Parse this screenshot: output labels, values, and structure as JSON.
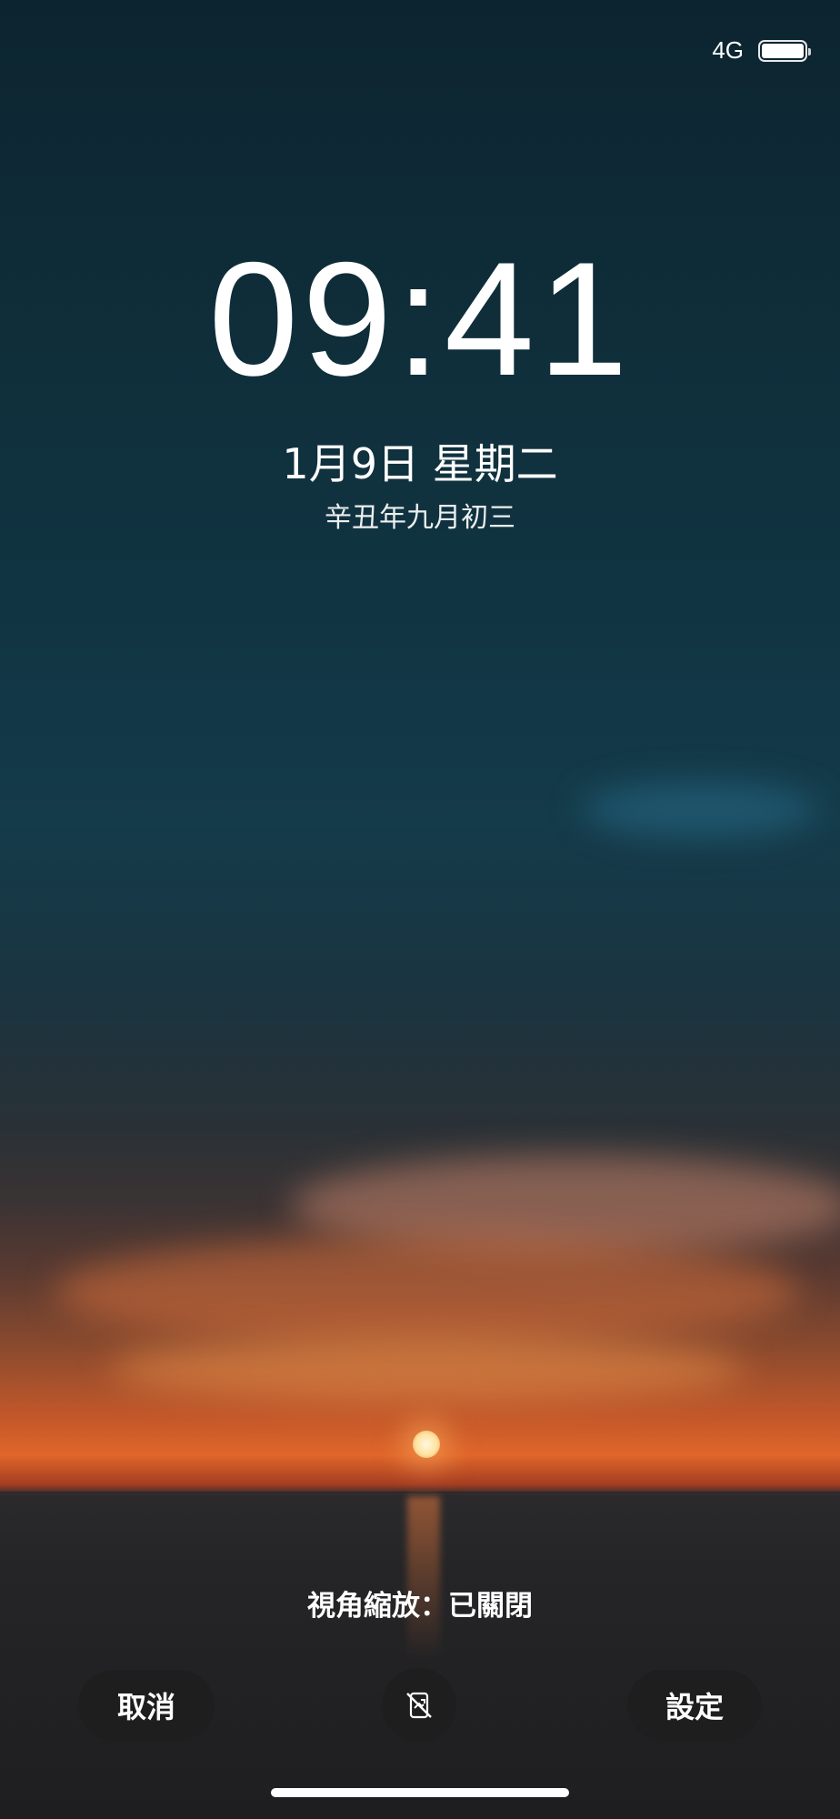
{
  "status_bar": {
    "network": "4G",
    "battery_level": 1.0,
    "battery_icon": "battery-icon"
  },
  "lock_screen": {
    "time": "09:41",
    "date": "1月9日 星期二",
    "lunar_date": "辛丑年九月初三"
  },
  "controls": {
    "zoom_status": "視角縮放：已關閉",
    "cancel_label": "取消",
    "settings_label": "設定",
    "zoom_toggle_icon": "perspective-zoom-off-icon"
  }
}
